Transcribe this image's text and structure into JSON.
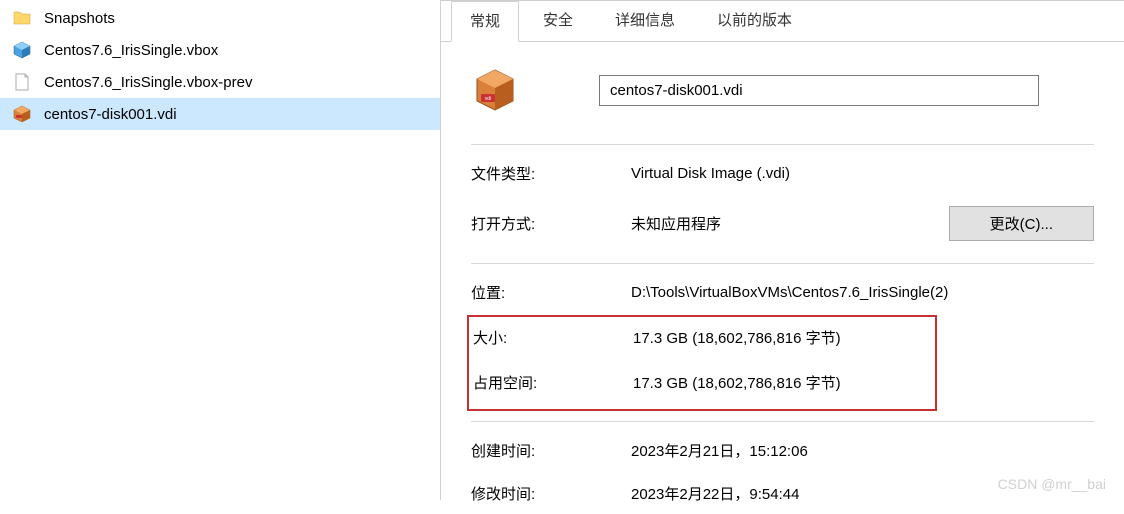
{
  "file_list": {
    "items": [
      {
        "name": "Snapshots",
        "icon": "folder-icon",
        "selected": false
      },
      {
        "name": "Centos7.6_IrisSingle.vbox",
        "icon": "vbox-icon",
        "selected": false
      },
      {
        "name": "Centos7.6_IrisSingle.vbox-prev",
        "icon": "file-icon",
        "selected": false
      },
      {
        "name": "centos7-disk001.vdi",
        "icon": "vdi-icon",
        "selected": true
      }
    ]
  },
  "tabs": {
    "items": [
      {
        "label": "常规",
        "active": true
      },
      {
        "label": "安全",
        "active": false
      },
      {
        "label": "详细信息",
        "active": false
      },
      {
        "label": "以前的版本",
        "active": false
      }
    ]
  },
  "properties": {
    "file_name": "centos7-disk001.vdi",
    "file_type_label": "文件类型:",
    "file_type_value": "Virtual Disk Image (.vdi)",
    "open_with_label": "打开方式:",
    "open_with_value": "未知应用程序",
    "change_button": "更改(C)...",
    "location_label": "位置:",
    "location_value": "D:\\Tools\\VirtualBoxVMs\\Centos7.6_IrisSingle(2)",
    "size_label": "大小:",
    "size_value": "17.3 GB (18,602,786,816 字节)",
    "disk_size_label": "占用空间:",
    "disk_size_value": "17.3 GB (18,602,786,816 字节)",
    "created_label": "创建时间:",
    "created_value": "2023年2月21日，15:12:06",
    "modified_label": "修改时间:",
    "modified_value": "2023年2月22日，9:54:44"
  },
  "watermark": "CSDN @mr__bai"
}
